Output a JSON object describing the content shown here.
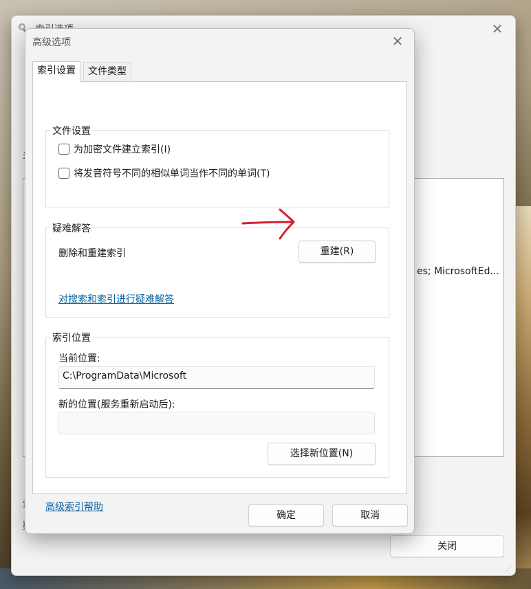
{
  "back_window": {
    "title": "索引选项",
    "side_text": "关",
    "list_text": "es; MicrosoftEd...",
    "link_fragment_1": "索",
    "link_fragment_2": "疑",
    "close_button": "关闭"
  },
  "dialog": {
    "title": "高级选项",
    "tabs": [
      {
        "label": "索引设置",
        "active": true
      },
      {
        "label": "文件类型",
        "active": false
      }
    ],
    "file_settings": {
      "legend": "文件设置",
      "checkboxes": [
        {
          "label": "为加密文件建立索引(I)",
          "checked": false
        },
        {
          "label": "将发音符号不同的相似单词当作不同的单词(T)",
          "checked": false
        }
      ]
    },
    "troubleshooting": {
      "legend": "疑难解答",
      "rebuild_label": "删除和重建索引",
      "rebuild_button": "重建(R)",
      "troubleshoot_link": "对搜索和索引进行疑难解答"
    },
    "index_location": {
      "legend": "索引位置",
      "current_label": "当前位置:",
      "current_value": "C:\\ProgramData\\Microsoft",
      "new_label": "新的位置(服务重新启动后):",
      "new_value": "",
      "select_button": "选择新位置(N)"
    },
    "help_link": "高级索引帮助",
    "ok_button": "确定",
    "cancel_button": "取消"
  },
  "colors": {
    "link": "#0a64a4",
    "annotation_arrow": "#d0202a",
    "window_bg": "#f3f3f3"
  }
}
